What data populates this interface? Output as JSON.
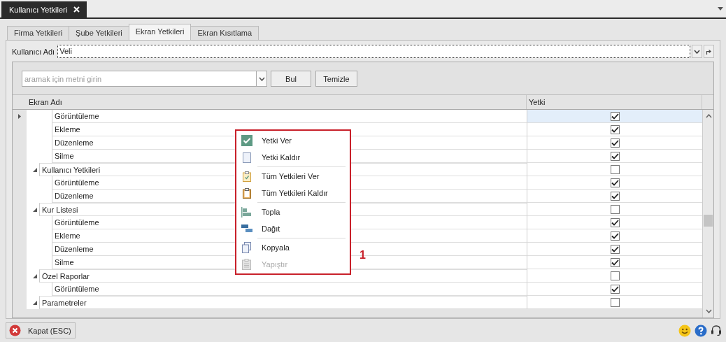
{
  "document_tab": {
    "title": "Kullanıcı Yetkileri"
  },
  "tabs": [
    {
      "label": "Firma Yetkileri",
      "selected": false
    },
    {
      "label": "Şube Yetkileri",
      "selected": false
    },
    {
      "label": "Ekran Yetkileri",
      "selected": true
    },
    {
      "label": "Ekran Kısıtlama",
      "selected": false
    }
  ],
  "user_field": {
    "label": "Kullanıcı Adı",
    "value": "Veli"
  },
  "search": {
    "placeholder": "aramak için metni girin",
    "buttons": [
      "Bul",
      "Temizle"
    ]
  },
  "grid": {
    "columns": [
      "Ekran Adı",
      "Yetki"
    ],
    "tree": [
      {
        "children": [
          {
            "label": "Görüntüleme",
            "checked": true,
            "selected": true
          },
          {
            "label": "Ekleme",
            "checked": true,
            "selected": false
          },
          {
            "label": "Düzenleme",
            "checked": true,
            "selected": false
          },
          {
            "label": "Silme",
            "checked": true,
            "selected": false
          }
        ]
      },
      {
        "label": "Kullanıcı Yetkileri",
        "expanded": true,
        "checked": false,
        "selected": false,
        "children": [
          {
            "label": "Görüntüleme",
            "checked": true,
            "selected": false
          },
          {
            "label": "Düzenleme",
            "checked": true,
            "selected": false
          }
        ]
      },
      {
        "label": "Kur Listesi",
        "expanded": true,
        "checked": false,
        "selected": false,
        "children": [
          {
            "label": "Görüntüleme",
            "checked": true,
            "selected": false
          },
          {
            "label": "Ekleme",
            "checked": true,
            "selected": false
          },
          {
            "label": "Düzenleme",
            "checked": true,
            "selected": false
          },
          {
            "label": "Silme",
            "checked": true,
            "selected": false
          }
        ]
      },
      {
        "label": "Özel Raporlar",
        "expanded": true,
        "checked": false,
        "selected": false,
        "children": [
          {
            "label": "Görüntüleme",
            "checked": true,
            "selected": false
          }
        ]
      },
      {
        "label": "Parametreler",
        "expanded": true,
        "checked": false,
        "selected": false
      }
    ]
  },
  "context_menu": {
    "groups": [
      [
        {
          "label": "Yetki Ver",
          "disabled": false
        },
        {
          "label": "Yetki Kaldır",
          "disabled": false
        }
      ],
      [
        {
          "label": "Tüm Yetkileri Ver",
          "disabled": false
        },
        {
          "label": "Tüm Yetkileri Kaldır",
          "disabled": false
        }
      ],
      [
        {
          "label": "Topla",
          "disabled": false
        },
        {
          "label": "Dağıt",
          "disabled": false
        }
      ],
      [
        {
          "label": "Kopyala",
          "disabled": false
        },
        {
          "label": "Yapıştır",
          "disabled": true
        }
      ]
    ]
  },
  "annotation": "1",
  "footer": {
    "close_button": "Kapat (ESC)"
  }
}
